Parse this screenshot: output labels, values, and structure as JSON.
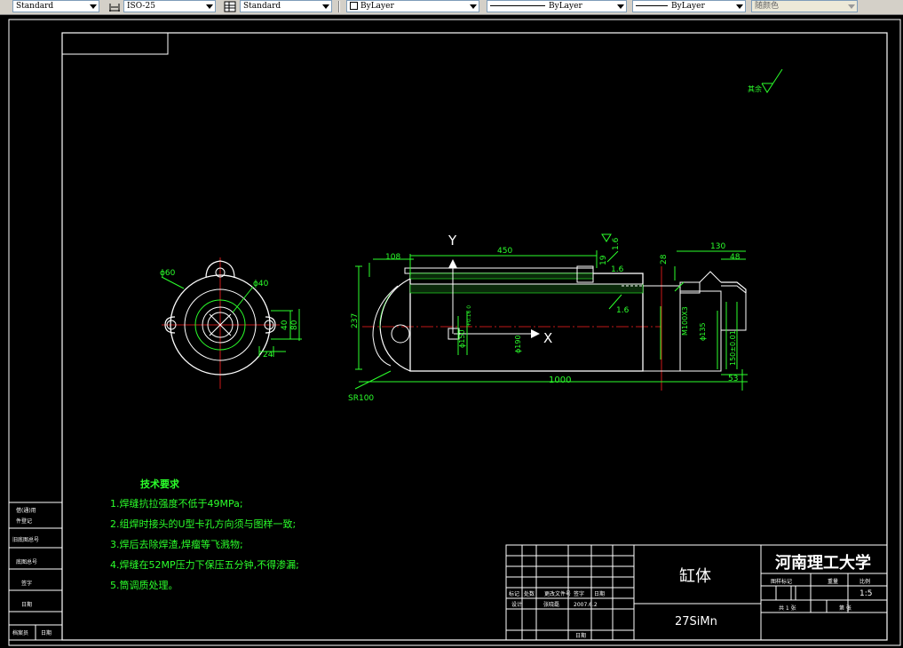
{
  "toolbar": {
    "text_style": "Standard",
    "dim_style": "ISO-25",
    "table_style": "Standard",
    "layer": "ByLayer",
    "linetype": "ByLayer",
    "lineweight": "ByLayer",
    "color": "随颜色"
  },
  "drawing": {
    "surface_mark": "其余",
    "dims": {
      "d60": "ϕ60",
      "d40": "ϕ40",
      "d40v": "40",
      "d80v": "80",
      "d24": "24",
      "d108": "108",
      "d450": "450",
      "d19": "19",
      "d16a": "1.6",
      "d16b": "1.6",
      "d16c": "1.6",
      "d28": "28",
      "d130": "130",
      "d48": "48",
      "d237": "237",
      "d1000": "1000",
      "d53": "53",
      "sr100": "SR100",
      "phi150": "ϕ150",
      "phi190": "ϕ190",
      "m100": "M100X3",
      "phi135": "ϕ135",
      "phi150tol": "150±0.01",
      "tol016": "+0.16 0",
      "y_axis": "Y",
      "x_axis": "X"
    },
    "tech_req": {
      "title": "技术要求",
      "items": [
        "1.焊缝抗拉强度不低于49MPa;",
        "2.组焊时接头的U型卡孔方向须与图样一致;",
        "3.焊后去除焊渣,焊瘤等飞溅物;",
        "4.焊缝在52MP压力下保压五分钟,不得渗漏;",
        "5.筒调质处理。"
      ]
    },
    "side_table": [
      "借(通)用",
      "件登记",
      "旧底图总号",
      "底图总号",
      "签字",
      "日期",
      "档案员",
      "日期"
    ],
    "title_block": {
      "part_name": "缸体",
      "material": "27SiMn",
      "school": "河南理工大学",
      "scale": "1:5",
      "stage_mark": "图样标记",
      "weight": "重量",
      "scale_label": "比例",
      "sheet_total": "共 1 张",
      "sheet_no": "第 张",
      "rev_labels": [
        "标记",
        "处数",
        "更改文件号",
        "签字",
        "日期"
      ],
      "design_label": "设计",
      "designer": "张晓磊",
      "design_date": "2007.6.2",
      "date_label": "日期"
    }
  }
}
